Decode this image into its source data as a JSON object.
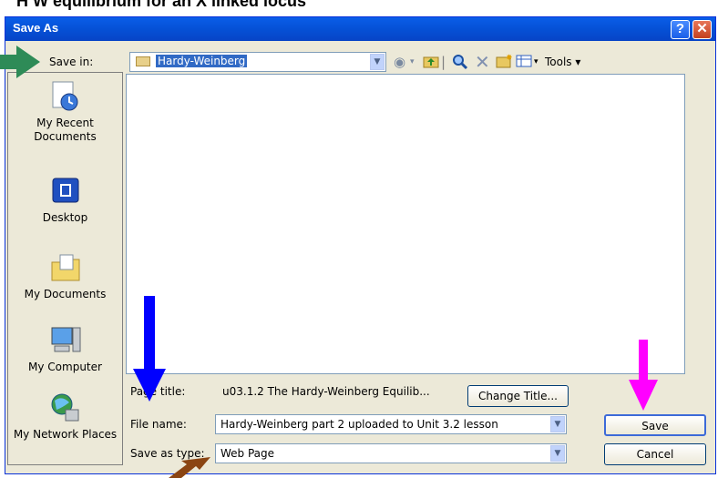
{
  "background_heading": "H W equilibrium for an X linked locus",
  "dialog": {
    "title": "Save As",
    "help_label": "?",
    "close_label": "✕"
  },
  "save_in": {
    "label": "Save in:",
    "folder": "Hardy-Weinberg"
  },
  "toolbar": {
    "tools_label": "Tools",
    "back_icon": "back-icon",
    "up_icon": "up-folder-icon",
    "search_icon": "search-web-icon",
    "delete_icon": "delete-icon",
    "new_folder_icon": "new-folder-icon",
    "views_icon": "views-icon"
  },
  "places": [
    {
      "name": "recent-documents",
      "label": "My Recent Documents"
    },
    {
      "name": "desktop",
      "label": "Desktop"
    },
    {
      "name": "my-documents",
      "label": "My Documents"
    },
    {
      "name": "my-computer",
      "label": "My Computer"
    },
    {
      "name": "my-network-places",
      "label": "My Network Places"
    }
  ],
  "page_title": {
    "label": "Page title:",
    "value": "u03.1.2 The Hardy-Weinberg Equilib...",
    "button": "Change Title..."
  },
  "file_name": {
    "label": "File name:",
    "value": "Hardy-Weinberg part 2 uploaded to Unit 3.2 lesson"
  },
  "save_as_type": {
    "label": "Save as type:",
    "value": "Web Page"
  },
  "buttons": {
    "save": "Save",
    "cancel": "Cancel"
  },
  "colors": {
    "titlebar": "#0551d6",
    "dialog_bg": "#ece9d8",
    "arrow_green": "#2e8b57",
    "arrow_blue": "#0000ff",
    "arrow_magenta": "#ff00ff",
    "arrow_brown": "#8b4513"
  }
}
